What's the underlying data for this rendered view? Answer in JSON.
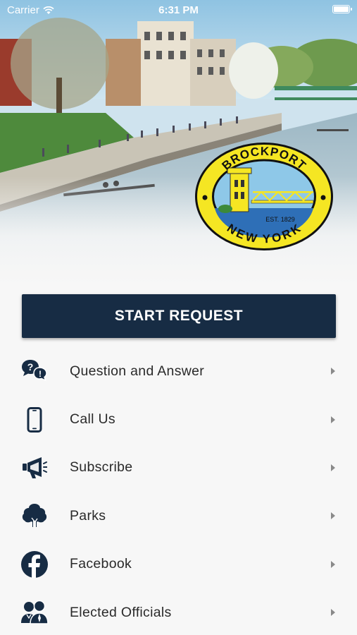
{
  "status_bar": {
    "carrier": "Carrier",
    "time": "6:31 PM",
    "battery_level": 1.0
  },
  "hero": {
    "seal": {
      "top_text": "BROCKPORT",
      "bottom_text": "NEW YORK",
      "established": "EST. 1829"
    }
  },
  "start_request": {
    "label": "START REQUEST"
  },
  "menu": {
    "items": [
      {
        "label": "Question and Answer",
        "icon": "question-answer-icon"
      },
      {
        "label": "Call Us",
        "icon": "phone-icon"
      },
      {
        "label": "Subscribe",
        "icon": "megaphone-icon"
      },
      {
        "label": "Parks",
        "icon": "tree-icon"
      },
      {
        "label": "Facebook",
        "icon": "facebook-icon"
      },
      {
        "label": "Elected Officials",
        "icon": "officials-icon"
      }
    ]
  },
  "colors": {
    "primary": "#172c44",
    "seal_yellow": "#f5e623",
    "seal_blue": "#2e6fb7"
  }
}
